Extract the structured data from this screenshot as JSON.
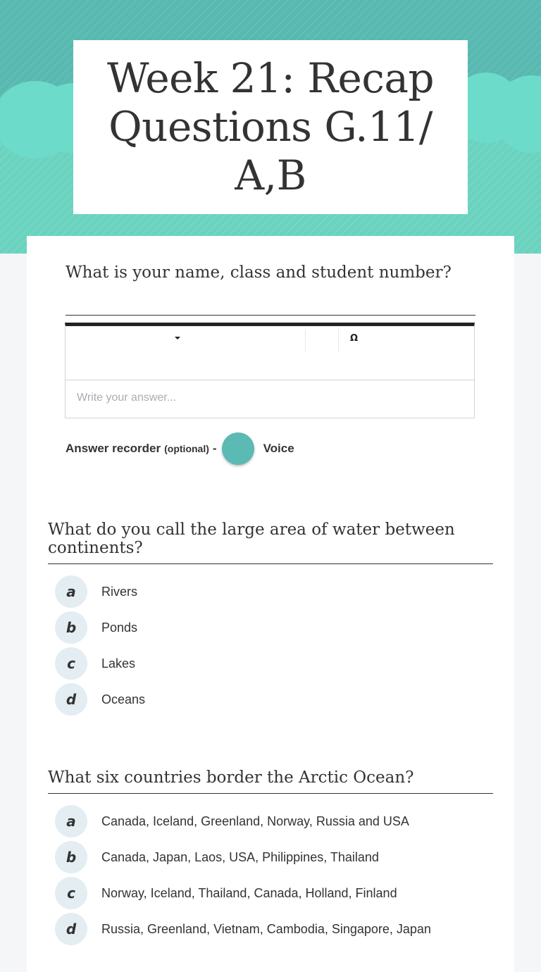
{
  "worksheet": {
    "title": "Week 21: Recap Questions G.11/ A,B",
    "accent_color": "#57b9b0",
    "cloud_color": "#6ad3bf"
  },
  "q1": {
    "text": "What is your name, class and student number?",
    "editor_placeholder": "Write your answer...",
    "toolbar": {
      "dropdown_icon": "caret-down-icon",
      "special_char": "Ω"
    },
    "recorder_label": "Answer recorder",
    "recorder_optional": "(optional)",
    "recorder_dash": "-",
    "voice_label": "Voice"
  },
  "q2": {
    "text": "What do you call the large area of water between continents?",
    "options": [
      {
        "letter": "a",
        "text": "Rivers"
      },
      {
        "letter": "b",
        "text": "Ponds"
      },
      {
        "letter": "c",
        "text": "Lakes"
      },
      {
        "letter": "d",
        "text": "Oceans"
      }
    ]
  },
  "q3": {
    "text": "What six countries border the Arctic Ocean?",
    "options": [
      {
        "letter": "a",
        "text": "Canada, Iceland, Greenland, Norway, Russia and USA"
      },
      {
        "letter": "b",
        "text": "Canada, Japan, Laos, USA, Philippines, Thailand"
      },
      {
        "letter": "c",
        "text": "Norway, Iceland, Thailand, Canada, Holland, Finland"
      },
      {
        "letter": "d",
        "text": "Russia, Greenland, Vietnam, Cambodia, Singapore, Japan"
      }
    ]
  }
}
